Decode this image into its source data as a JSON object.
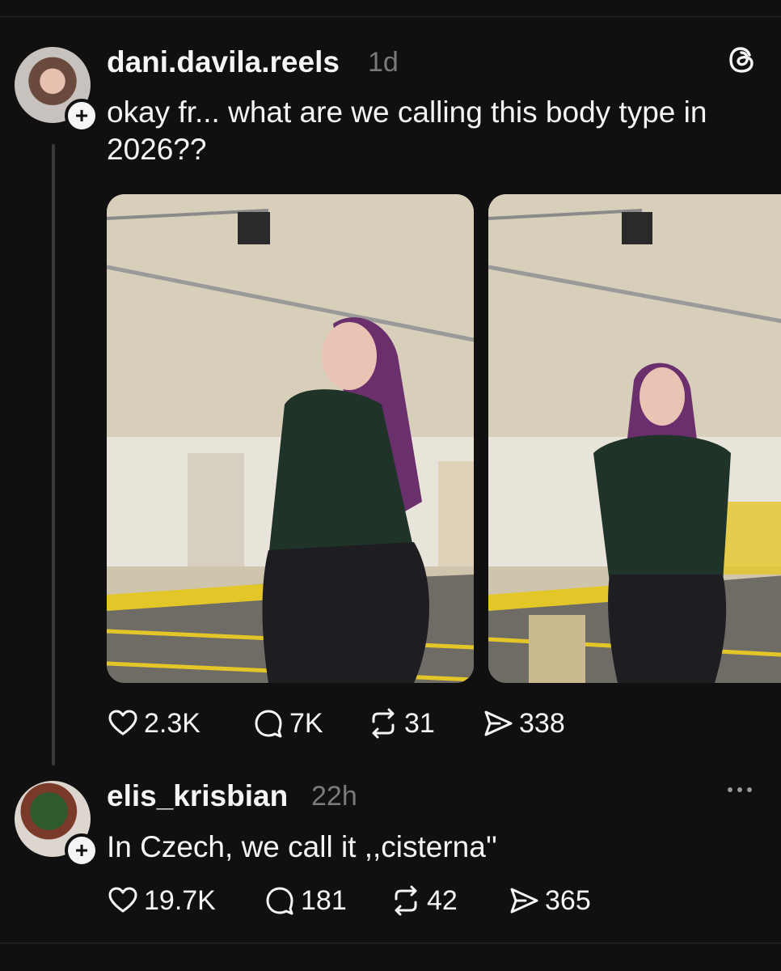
{
  "post": {
    "username": "dani.davila.reels",
    "time": "1d",
    "text": "okay fr... what are we calling this body type in 2026??",
    "stats": {
      "likes": "2.3K",
      "replies": "7K",
      "reposts": "31",
      "shares": "338"
    }
  },
  "reply": {
    "username": "elis_krisbian",
    "time": "22h",
    "text": "In Czech, we call it ,,cisterna''",
    "stats": {
      "likes": "19.7K",
      "replies": "181",
      "reposts": "42",
      "shares": "365"
    }
  },
  "icons": {
    "follow": "plus-icon",
    "app": "threads-logo-icon",
    "more": "more-horizontal-icon",
    "like": "heart-icon",
    "reply": "comment-icon",
    "repost": "repost-icon",
    "share": "send-icon"
  },
  "colors": {
    "background": "#101010",
    "text": "#f3f5f7",
    "muted": "#7a7a7a"
  }
}
